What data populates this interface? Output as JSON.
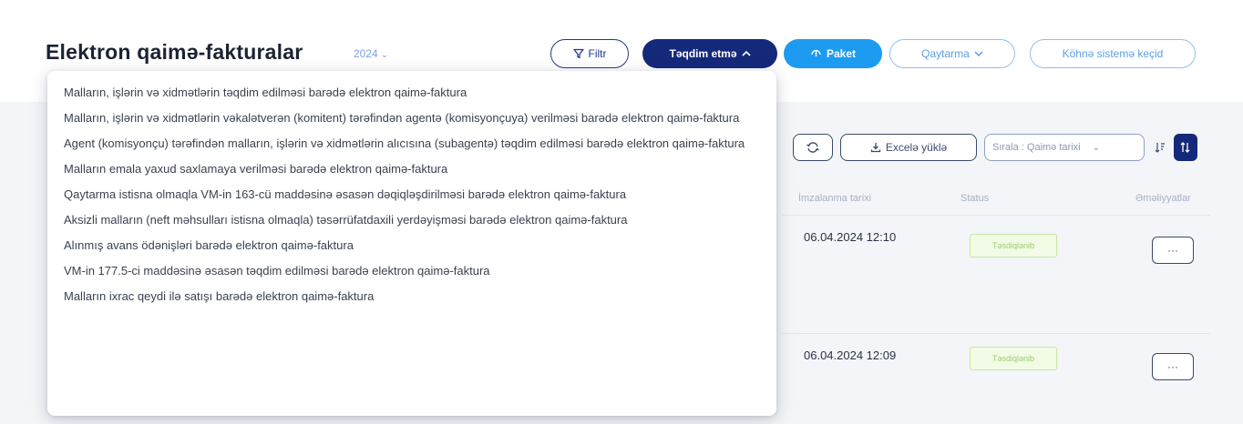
{
  "header": {
    "title": "Elektron qaimə-fakturalar",
    "year": "2024",
    "buttons": {
      "filter": "Filtr",
      "submit": "Təqdim etmə",
      "package": "Paket",
      "return": "Qaytarma",
      "old_system": "Köhnə sistemə keçid"
    }
  },
  "toolbar": {
    "excel": "Excelə yüklə",
    "sort": "Sırala : Qaimə tarixi"
  },
  "table": {
    "columns": [
      "İmzalanma tarixi",
      "Status",
      "Əməliyyatlar"
    ],
    "rows": [
      {
        "signed": "06.04.2024 12:10",
        "status": "Təsdiqlənib"
      },
      {
        "signed": "06.04.2024 12:09",
        "status": "Təsdiqlənib"
      }
    ]
  },
  "dropdown": {
    "items": [
      "Malların, işlərin və xidmətlərin təqdim edilməsi barədə elektron qaimə-faktura",
      "Malların, işlərin və xidmətlərin vəkalətverən (komitent) tərəfindən agentə (komisyonçuya) verilməsi barədə elektron qaimə-faktura",
      "Agent (komisyonçu) tərəfindən malların, işlərin və xidmətlərin alıcısına (subagentə) təqdim edilməsi barədə elektron qaimə-faktura",
      "Malların emala yaxud saxlamaya verilməsi barədə elektron qaimə-faktura",
      "Qaytarma istisna olmaqla VM-in 163-cü maddəsinə əsasən dəqiqləşdirilməsi barədə elektron qaimə-faktura",
      "Aksizli malların (neft məhsulları istisna olmaqla) təsərrüfatdaxili yerdəyişməsi barədə elektron qaimə-faktura",
      "Alınmış avans ödənişləri barədə elektron qaimə-faktura",
      "VM-in 177.5-ci maddəsinə əsasən təqdim edilməsi barədə elektron qaimə-faktura",
      "Malların ixrac qeydi ilə satışı barədə elektron qaimə-faktura"
    ]
  }
}
